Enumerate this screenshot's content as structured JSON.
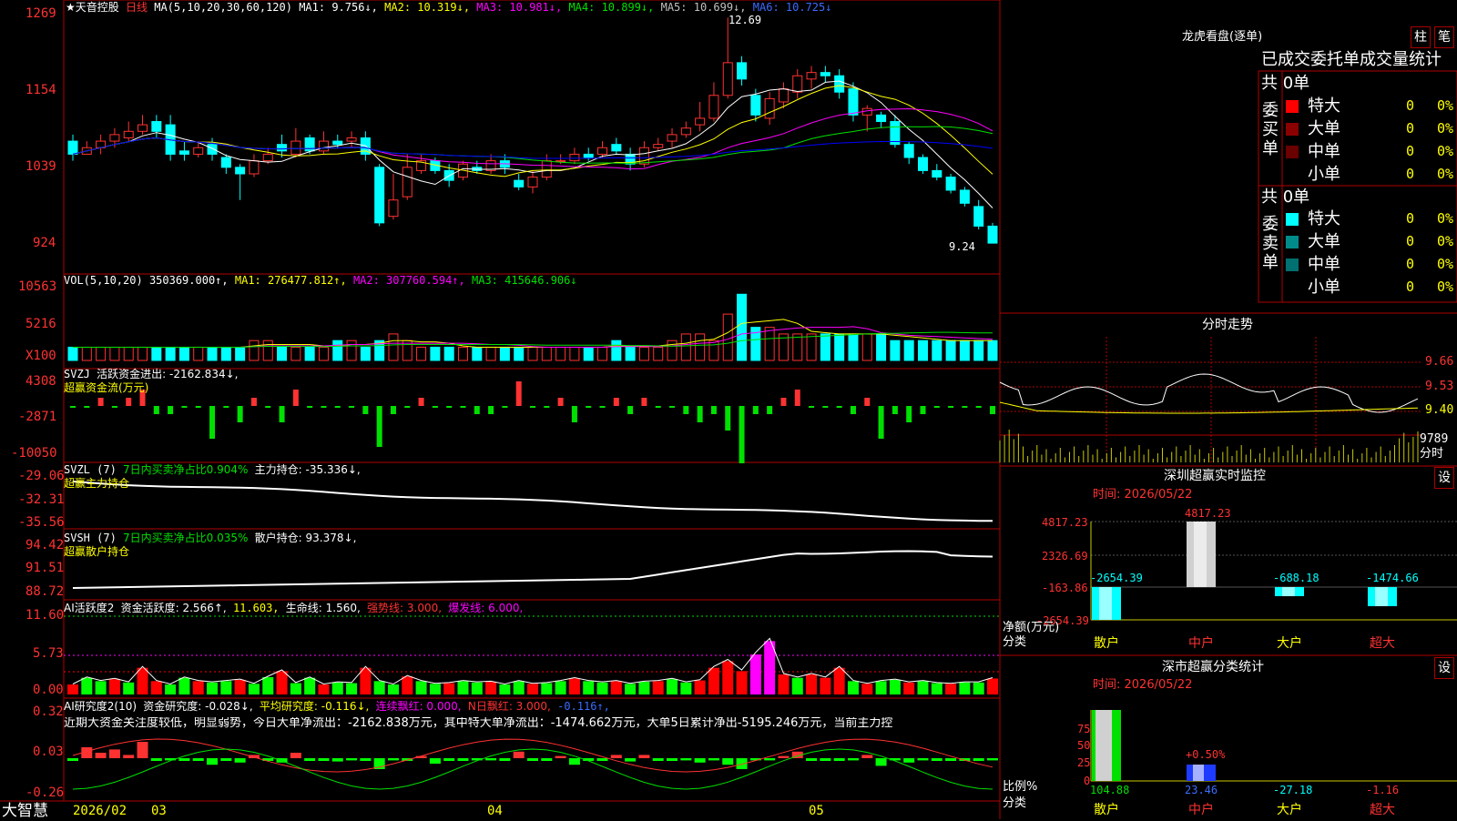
{
  "colors": {
    "up": "#ff3232",
    "down": "#00ffff",
    "ma1": "#ffffff",
    "ma2": "#ffff00",
    "ma3": "#ff00ff",
    "ma4": "#00e000",
    "ma5": "#0000ff",
    "grid": "#b00000",
    "dash_red": "#b00000"
  },
  "header": {
    "stock_name": "★天音控股",
    "period": "日线",
    "ma_spec": "MA(5,10,20,30,60,120)",
    "ma1": "MA1: 9.756↓,",
    "ma2": "MA2: 10.319↓,",
    "ma3": "MA3: 10.981↓,",
    "ma4": "MA4: 10.899↓,",
    "ma5": "MA5: 10.699↓,",
    "ma6": "MA6: 10.725↓"
  },
  "price_axis": [
    "1269",
    "1154",
    "1039",
    "924"
  ],
  "price_marks": {
    "high": "12.69",
    "low": "9.24"
  },
  "vol": {
    "title": "VOL(5,10,20)",
    "v": "350369.000↑,",
    "ma1": "MA1: 276477.812↑,",
    "ma2": "MA2: 307760.594↑,",
    "ma3": "MA3: 415646.906↓",
    "axis": [
      "10563",
      "5216",
      "X100"
    ]
  },
  "svzj": {
    "title": "SVZJ",
    "desc": "活跃资金进出: -2162.834↓,",
    "sub": "超赢资金流(万元)",
    "axis": [
      "4308",
      "-2871",
      "-10050"
    ]
  },
  "svzl": {
    "title": "SVZL (7)",
    "p1": "7日内买卖净占比0.904%",
    "p2": "主力持仓: -35.336↓,",
    "sub": "超赢主力持仓",
    "axis": [
      "-29.06",
      "-32.31",
      "-35.56"
    ]
  },
  "svsh": {
    "title": "SVSH (7)",
    "p1": "7日内买卖净占比0.035%",
    "p2": "散户持仓: 93.378↓,",
    "sub": "超赢散户持仓",
    "axis": [
      "94.42",
      "91.51",
      "88.72"
    ]
  },
  "ai1": {
    "title": "AI活跃度2",
    "p1": "资金活跃度: 2.566↑,",
    "p2": "11.603,",
    "p3": "生命线: 1.560,",
    "p4": "强势线: 3.000,",
    "p5": "爆发线: 6.000,",
    "axis": [
      "11.60",
      "5.73",
      "0.00"
    ]
  },
  "ai2": {
    "title": "AI研究度2(10)",
    "p1": "资金研究度: -0.028↓,",
    "p2": "平均研究度: -0.116↓,",
    "p3": "连续飘红: 0.000,",
    "p4": "N日飘红: 3.000,",
    "p5": "-0.116↑,",
    "text": "近期大资金关注度较低，明显弱势，今日大单净流出：-2162.838万元，其中特大单净流出：-1474.662万元，大单5日累计净出-5195.246万元，当前主力控",
    "axis": [
      "0.32",
      "0.03",
      "-0.26"
    ]
  },
  "bottom": {
    "brand": "大智慧",
    "dates": [
      "2026/02",
      "03",
      "04",
      "05"
    ]
  },
  "right": {
    "lhb_title": "龙虎看盘(逐单)",
    "btn1": "柱",
    "btn2": "笔",
    "tab_title": "已成交委托单成交量统计",
    "buy_label": "委买单",
    "sell_label": "委卖单",
    "buy_total": "共 0单",
    "sell_total": "共 0单",
    "buy_rows": [
      {
        "name": "特大",
        "n": "0",
        "p": "0%",
        "c": "#ff0000"
      },
      {
        "name": "大单",
        "n": "0",
        "p": "0%",
        "c": "#8b0000"
      },
      {
        "name": "中单",
        "n": "0",
        "p": "0%",
        "c": "#6a0000"
      },
      {
        "name": "小单",
        "n": "0",
        "p": "0%",
        "c": ""
      }
    ],
    "sell_rows": [
      {
        "name": "特大",
        "n": "0",
        "p": "0%",
        "c": "#00ffff"
      },
      {
        "name": "大单",
        "n": "0",
        "p": "0%",
        "c": "#008b8b"
      },
      {
        "name": "中单",
        "n": "0",
        "p": "0%",
        "c": "#007070"
      },
      {
        "name": "小单",
        "n": "0",
        "p": "0%",
        "c": ""
      }
    ],
    "fs_title": "分时走势",
    "fs_axis": [
      "9.66",
      "9.53",
      "9.40",
      "9789",
      "分时"
    ],
    "sz_title": "深圳超赢实时监控",
    "set": "设",
    "sz_time": "时间: 2026/05/22",
    "sz_axis": [
      "4817.23",
      "2326.69",
      "-163.86",
      "-2654.39"
    ],
    "sz_ylabel": "净额(万元)",
    "sz_xlabel": "分类",
    "sz_cats": [
      "散户",
      "中户",
      "大户",
      "超大"
    ],
    "sz_vals": [
      "-2654.39",
      "4817.23",
      "-688.18",
      "-1474.66"
    ],
    "fl_title": "深市超赢分类统计",
    "fl_time": "时间: 2026/05/22",
    "fl_axis": [
      "75",
      "50",
      "25",
      "0"
    ],
    "fl_ylabel": "比例%",
    "fl_xlabel": "分类",
    "fl_top": "+0.50%",
    "fl_vals": [
      "104.88",
      "23.46",
      "-27.18",
      "-1.16"
    ],
    "fl_cats": [
      "散户",
      "中户",
      "大户",
      "超大"
    ]
  },
  "chart_data": [
    {
      "type": "candlestick",
      "title": "天音控股 日线",
      "ylim": [
        9.24,
        12.69
      ],
      "ohlc": [
        [
          10.8,
          10.6,
          10.9,
          10.5
        ],
        [
          10.6,
          10.7,
          10.8,
          10.6
        ],
        [
          10.7,
          10.8,
          10.9,
          10.6
        ],
        [
          10.8,
          10.9,
          11.0,
          10.7
        ],
        [
          10.85,
          10.95,
          11.1,
          10.8
        ],
        [
          10.95,
          11.05,
          11.2,
          10.9
        ],
        [
          11.1,
          10.95,
          11.2,
          10.85
        ],
        [
          11.05,
          10.6,
          11.2,
          10.5
        ],
        [
          10.65,
          10.6,
          10.8,
          10.5
        ],
        [
          10.6,
          10.7,
          10.8,
          10.55
        ],
        [
          10.75,
          10.6,
          10.85,
          10.5
        ],
        [
          10.55,
          10.4,
          10.6,
          10.3
        ],
        [
          10.4,
          10.3,
          10.45,
          9.9
        ],
        [
          10.3,
          10.5,
          10.6,
          10.25
        ],
        [
          10.5,
          10.6,
          10.7,
          10.45
        ],
        [
          10.75,
          10.65,
          10.9,
          10.55
        ],
        [
          10.6,
          10.8,
          11.0,
          10.55
        ],
        [
          10.85,
          10.65,
          10.9,
          10.6
        ],
        [
          10.65,
          10.8,
          10.95,
          10.6
        ],
        [
          10.8,
          10.75,
          10.9,
          10.7
        ],
        [
          10.8,
          10.85,
          10.95,
          10.7
        ],
        [
          10.85,
          10.6,
          10.95,
          10.5
        ],
        [
          10.4,
          9.55,
          10.45,
          9.5
        ],
        [
          9.65,
          9.9,
          10.3,
          9.6
        ],
        [
          9.95,
          10.4,
          10.6,
          9.9
        ],
        [
          10.35,
          10.5,
          10.6,
          10.3
        ],
        [
          10.5,
          10.35,
          10.55,
          10.3
        ],
        [
          10.35,
          10.2,
          10.45,
          10.1
        ],
        [
          10.25,
          10.45,
          10.5,
          10.2
        ],
        [
          10.4,
          10.35,
          10.5,
          10.3
        ],
        [
          10.35,
          10.5,
          10.6,
          10.3
        ],
        [
          10.5,
          10.4,
          10.6,
          10.3
        ],
        [
          10.2,
          10.1,
          10.3,
          10.05
        ],
        [
          10.1,
          10.25,
          10.35,
          10.0
        ],
        [
          10.25,
          10.5,
          10.6,
          10.2
        ],
        [
          10.5,
          10.5,
          10.6,
          10.45
        ],
        [
          10.5,
          10.6,
          10.7,
          10.45
        ],
        [
          10.6,
          10.55,
          10.7,
          10.5
        ],
        [
          10.6,
          10.7,
          10.8,
          10.55
        ],
        [
          10.75,
          10.65,
          10.85,
          10.6
        ],
        [
          10.6,
          10.45,
          10.7,
          10.35
        ],
        [
          10.45,
          10.7,
          10.8,
          10.4
        ],
        [
          10.7,
          10.75,
          10.85,
          10.65
        ],
        [
          10.8,
          10.9,
          11.0,
          10.7
        ],
        [
          10.9,
          11.0,
          11.1,
          10.85
        ],
        [
          11.05,
          11.15,
          11.4,
          10.95
        ],
        [
          11.15,
          11.5,
          11.7,
          11.1
        ],
        [
          11.5,
          12.0,
          12.69,
          11.45
        ],
        [
          12.0,
          11.75,
          12.1,
          11.65
        ],
        [
          11.5,
          11.2,
          11.6,
          11.1
        ],
        [
          11.15,
          11.45,
          11.55,
          11.05
        ],
        [
          11.4,
          11.6,
          11.7,
          11.3
        ],
        [
          11.55,
          11.8,
          11.9,
          11.45
        ],
        [
          11.75,
          11.85,
          11.95,
          11.6
        ],
        [
          11.85,
          11.8,
          11.95,
          11.7
        ],
        [
          11.8,
          11.55,
          11.9,
          11.45
        ],
        [
          11.6,
          11.2,
          11.7,
          11.1
        ],
        [
          11.2,
          11.3,
          11.35,
          10.95
        ],
        [
          11.2,
          11.1,
          11.25,
          11.0
        ],
        [
          11.1,
          10.75,
          11.2,
          10.7
        ],
        [
          10.75,
          10.55,
          10.8,
          10.45
        ],
        [
          10.55,
          10.35,
          10.6,
          10.3
        ],
        [
          10.35,
          10.25,
          10.45,
          10.2
        ],
        [
          10.25,
          10.05,
          10.3,
          10.0
        ],
        [
          10.05,
          9.85,
          10.1,
          9.8
        ],
        [
          9.8,
          9.5,
          9.9,
          9.45
        ],
        [
          9.5,
          9.24,
          9.55,
          9.24
        ]
      ]
    },
    {
      "type": "bar",
      "title": "VOL(5,10,20)",
      "values": [
        2,
        2,
        2,
        2,
        2,
        2,
        2,
        2,
        2,
        2,
        2,
        2,
        2,
        3,
        3,
        2,
        2,
        2,
        2,
        3,
        3,
        2,
        3,
        4,
        3,
        2,
        2,
        2,
        2,
        2,
        2,
        2,
        2,
        2,
        2,
        2,
        2,
        2,
        2,
        3,
        2,
        2,
        2,
        3,
        4,
        4,
        3,
        7,
        10,
        5,
        5,
        4,
        4,
        4,
        4,
        4,
        4,
        4,
        4,
        3,
        3,
        3,
        3,
        3,
        3,
        3,
        3
      ]
    },
    {
      "type": "bar",
      "title": "超赢资金流(万元)",
      "values": [
        0,
        0,
        1,
        0,
        1,
        2,
        -1,
        -1,
        0,
        0,
        -4,
        0,
        -2,
        1,
        0,
        -2,
        2,
        0,
        0,
        0,
        0,
        -1,
        -5,
        -1,
        0,
        1,
        0,
        0,
        0,
        -1,
        -1,
        0,
        3,
        0,
        0,
        1,
        -2,
        0,
        0,
        1,
        -1,
        1,
        0,
        0,
        -1,
        -2,
        -1,
        -3,
        -7,
        -1,
        -1,
        1,
        2,
        0,
        0,
        0,
        -1,
        1,
        -4,
        -1,
        -2,
        -1,
        0,
        0,
        0,
        0,
        -1
      ]
    }
  ]
}
